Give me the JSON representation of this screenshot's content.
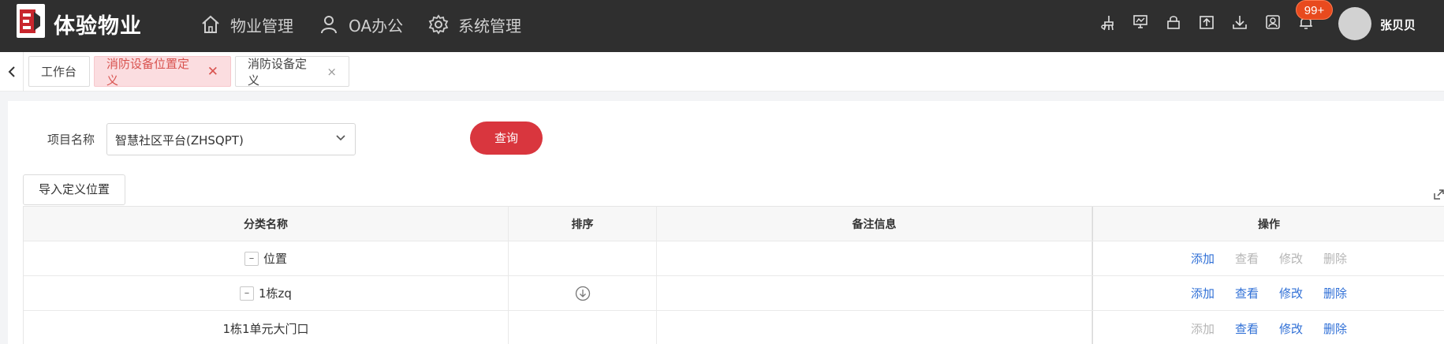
{
  "header": {
    "brand": "体验物业",
    "nav": [
      {
        "label": "物业管理",
        "icon": "home-icon"
      },
      {
        "label": "OA办公",
        "icon": "user-icon"
      },
      {
        "label": "系统管理",
        "icon": "gear-icon"
      }
    ],
    "tools": [
      "broom-icon",
      "monitor-icon",
      "lock-icon",
      "upload-icon",
      "download-icon",
      "contact-icon",
      "bell-icon"
    ],
    "notification_badge": "99+",
    "username": "张贝贝"
  },
  "tabs": [
    {
      "label": "工作台",
      "active": false,
      "closable": false
    },
    {
      "label": "消防设备位置定义",
      "active": true,
      "closable": true,
      "close_glyph": "✕"
    },
    {
      "label": "消防设备定义",
      "active": false,
      "closable": true,
      "close_glyph": "×"
    }
  ],
  "filter": {
    "label": "项目名称",
    "value": "智慧社区平台(ZHSQPT)",
    "query_label": "查询"
  },
  "import_label": "导入定义位置",
  "table": {
    "columns": [
      "分类名称",
      "排序",
      "备注信息",
      "操作"
    ],
    "rows": [
      {
        "name": "位置",
        "tree_toggle": "–",
        "sort_icon": "",
        "remark": "",
        "ops": [
          {
            "label": "添加",
            "enabled": true
          },
          {
            "label": "查看",
            "enabled": false
          },
          {
            "label": "修改",
            "enabled": false
          },
          {
            "label": "删除",
            "enabled": false
          }
        ]
      },
      {
        "name": "1栋zq",
        "tree_toggle": "–",
        "sort_icon": "arrow-down-circle-icon",
        "remark": "",
        "ops": [
          {
            "label": "添加",
            "enabled": true
          },
          {
            "label": "查看",
            "enabled": true
          },
          {
            "label": "修改",
            "enabled": true
          },
          {
            "label": "删除",
            "enabled": true
          }
        ]
      },
      {
        "name": "1栋1单元大门口",
        "tree_toggle": "",
        "sort_icon": "",
        "remark": "",
        "ops": [
          {
            "label": "添加",
            "enabled": false
          },
          {
            "label": "查看",
            "enabled": true
          },
          {
            "label": "修改",
            "enabled": true
          },
          {
            "label": "删除",
            "enabled": true
          }
        ]
      }
    ]
  },
  "colors": {
    "topbar": "#2f2f2f",
    "accent_red": "#d9363e",
    "link_blue": "#2f6fd6",
    "disabled_gray": "#b5b5b5",
    "active_tab_bg": "#fbdde0"
  }
}
